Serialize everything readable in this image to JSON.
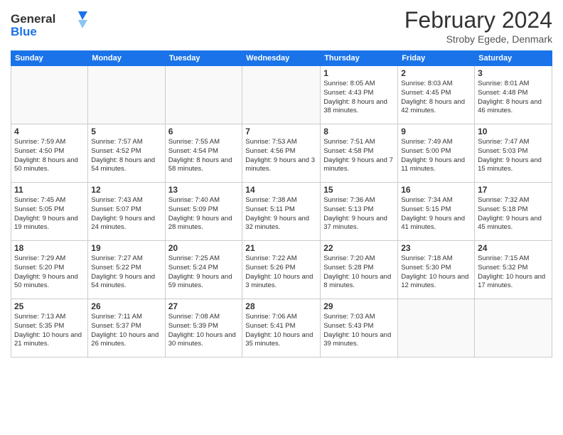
{
  "header": {
    "logo_line1": "General",
    "logo_line2": "Blue",
    "month": "February 2024",
    "location": "Stroby Egede, Denmark"
  },
  "weekdays": [
    "Sunday",
    "Monday",
    "Tuesday",
    "Wednesday",
    "Thursday",
    "Friday",
    "Saturday"
  ],
  "weeks": [
    [
      {
        "day": "",
        "info": ""
      },
      {
        "day": "",
        "info": ""
      },
      {
        "day": "",
        "info": ""
      },
      {
        "day": "",
        "info": ""
      },
      {
        "day": "1",
        "info": "Sunrise: 8:05 AM\nSunset: 4:43 PM\nDaylight: 8 hours\nand 38 minutes."
      },
      {
        "day": "2",
        "info": "Sunrise: 8:03 AM\nSunset: 4:45 PM\nDaylight: 8 hours\nand 42 minutes."
      },
      {
        "day": "3",
        "info": "Sunrise: 8:01 AM\nSunset: 4:48 PM\nDaylight: 8 hours\nand 46 minutes."
      }
    ],
    [
      {
        "day": "4",
        "info": "Sunrise: 7:59 AM\nSunset: 4:50 PM\nDaylight: 8 hours\nand 50 minutes."
      },
      {
        "day": "5",
        "info": "Sunrise: 7:57 AM\nSunset: 4:52 PM\nDaylight: 8 hours\nand 54 minutes."
      },
      {
        "day": "6",
        "info": "Sunrise: 7:55 AM\nSunset: 4:54 PM\nDaylight: 8 hours\nand 58 minutes."
      },
      {
        "day": "7",
        "info": "Sunrise: 7:53 AM\nSunset: 4:56 PM\nDaylight: 9 hours\nand 3 minutes."
      },
      {
        "day": "8",
        "info": "Sunrise: 7:51 AM\nSunset: 4:58 PM\nDaylight: 9 hours\nand 7 minutes."
      },
      {
        "day": "9",
        "info": "Sunrise: 7:49 AM\nSunset: 5:00 PM\nDaylight: 9 hours\nand 11 minutes."
      },
      {
        "day": "10",
        "info": "Sunrise: 7:47 AM\nSunset: 5:03 PM\nDaylight: 9 hours\nand 15 minutes."
      }
    ],
    [
      {
        "day": "11",
        "info": "Sunrise: 7:45 AM\nSunset: 5:05 PM\nDaylight: 9 hours\nand 19 minutes."
      },
      {
        "day": "12",
        "info": "Sunrise: 7:43 AM\nSunset: 5:07 PM\nDaylight: 9 hours\nand 24 minutes."
      },
      {
        "day": "13",
        "info": "Sunrise: 7:40 AM\nSunset: 5:09 PM\nDaylight: 9 hours\nand 28 minutes."
      },
      {
        "day": "14",
        "info": "Sunrise: 7:38 AM\nSunset: 5:11 PM\nDaylight: 9 hours\nand 32 minutes."
      },
      {
        "day": "15",
        "info": "Sunrise: 7:36 AM\nSunset: 5:13 PM\nDaylight: 9 hours\nand 37 minutes."
      },
      {
        "day": "16",
        "info": "Sunrise: 7:34 AM\nSunset: 5:15 PM\nDaylight: 9 hours\nand 41 minutes."
      },
      {
        "day": "17",
        "info": "Sunrise: 7:32 AM\nSunset: 5:18 PM\nDaylight: 9 hours\nand 45 minutes."
      }
    ],
    [
      {
        "day": "18",
        "info": "Sunrise: 7:29 AM\nSunset: 5:20 PM\nDaylight: 9 hours\nand 50 minutes."
      },
      {
        "day": "19",
        "info": "Sunrise: 7:27 AM\nSunset: 5:22 PM\nDaylight: 9 hours\nand 54 minutes."
      },
      {
        "day": "20",
        "info": "Sunrise: 7:25 AM\nSunset: 5:24 PM\nDaylight: 9 hours\nand 59 minutes."
      },
      {
        "day": "21",
        "info": "Sunrise: 7:22 AM\nSunset: 5:26 PM\nDaylight: 10 hours\nand 3 minutes."
      },
      {
        "day": "22",
        "info": "Sunrise: 7:20 AM\nSunset: 5:28 PM\nDaylight: 10 hours\nand 8 minutes."
      },
      {
        "day": "23",
        "info": "Sunrise: 7:18 AM\nSunset: 5:30 PM\nDaylight: 10 hours\nand 12 minutes."
      },
      {
        "day": "24",
        "info": "Sunrise: 7:15 AM\nSunset: 5:32 PM\nDaylight: 10 hours\nand 17 minutes."
      }
    ],
    [
      {
        "day": "25",
        "info": "Sunrise: 7:13 AM\nSunset: 5:35 PM\nDaylight: 10 hours\nand 21 minutes."
      },
      {
        "day": "26",
        "info": "Sunrise: 7:11 AM\nSunset: 5:37 PM\nDaylight: 10 hours\nand 26 minutes."
      },
      {
        "day": "27",
        "info": "Sunrise: 7:08 AM\nSunset: 5:39 PM\nDaylight: 10 hours\nand 30 minutes."
      },
      {
        "day": "28",
        "info": "Sunrise: 7:06 AM\nSunset: 5:41 PM\nDaylight: 10 hours\nand 35 minutes."
      },
      {
        "day": "29",
        "info": "Sunrise: 7:03 AM\nSunset: 5:43 PM\nDaylight: 10 hours\nand 39 minutes."
      },
      {
        "day": "",
        "info": ""
      },
      {
        "day": "",
        "info": ""
      }
    ]
  ]
}
